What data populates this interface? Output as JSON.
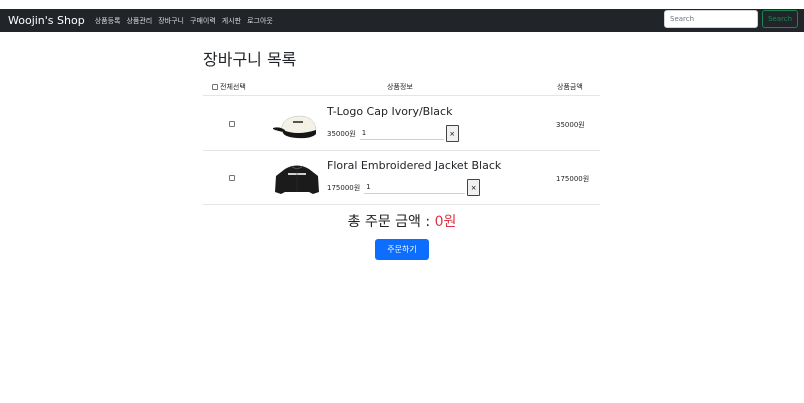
{
  "navbar": {
    "brand": "Woojin's Shop",
    "links": [
      "상품등록",
      "상품관리",
      "장바구니",
      "구매이력",
      "게시판",
      "로그아웃"
    ],
    "search": {
      "placeholder": "Search",
      "value": ""
    },
    "search_button": "Search"
  },
  "cart": {
    "title": "장바구니 목록",
    "headers": {
      "select_all": "전체선택",
      "product_info": "상품정보",
      "product_price": "상품금액"
    },
    "items": [
      {
        "name": "T-Logo Cap Ivory/Black",
        "price": "35000원",
        "quantity": "1",
        "delete_label": "×",
        "total": "35000원"
      },
      {
        "name": "Floral Embroidered Jacket Black",
        "price": "175000원",
        "quantity": "1",
        "delete_label": "×",
        "total": "175000원"
      }
    ],
    "total_label": "총 주문 금액 : ",
    "total_amount": "0원",
    "order_button": "주문하기"
  },
  "colors": {
    "navbar_bg": "#212529",
    "search_button": "#198754",
    "total_amount": "#dc3545",
    "order_button": "#0d6efd"
  }
}
